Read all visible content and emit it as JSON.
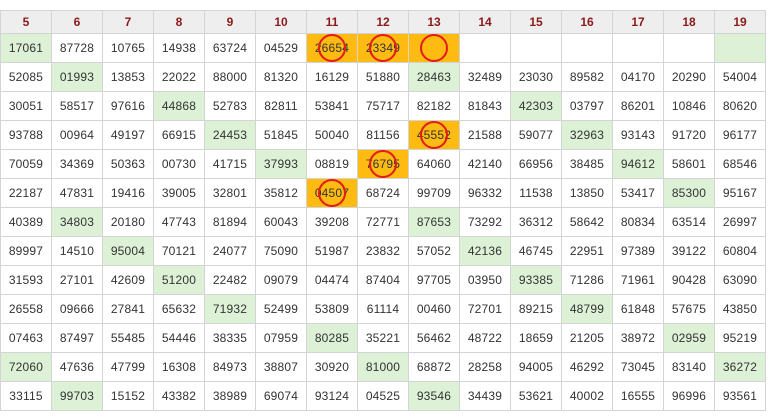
{
  "headers": [
    "5",
    "6",
    "7",
    "8",
    "9",
    "10",
    "11",
    "12",
    "13",
    "14",
    "15",
    "16",
    "17",
    "18",
    "19"
  ],
  "rows": [
    [
      "17061",
      "87728",
      "10765",
      "14938",
      "63724",
      "04529",
      "26654",
      "23349",
      "",
      "",
      "",
      "",
      "",
      "",
      ""
    ],
    [
      "52085",
      "01993",
      "13853",
      "22022",
      "88000",
      "81320",
      "16129",
      "51880",
      "28463",
      "32489",
      "23030",
      "89582",
      "04170",
      "20290",
      "54004"
    ],
    [
      "30051",
      "58517",
      "97616",
      "44868",
      "52783",
      "82811",
      "53841",
      "75717",
      "82182",
      "81843",
      "42303",
      "03797",
      "86201",
      "10846",
      "80620"
    ],
    [
      "93788",
      "00964",
      "49197",
      "66915",
      "24453",
      "51845",
      "50040",
      "81156",
      "45552",
      "21588",
      "59077",
      "32963",
      "93143",
      "91720",
      "96177"
    ],
    [
      "70059",
      "34369",
      "50363",
      "00730",
      "41715",
      "37993",
      "08819",
      "76795",
      "64060",
      "42140",
      "66956",
      "38485",
      "94612",
      "58601",
      "68546"
    ],
    [
      "22187",
      "47831",
      "19416",
      "39005",
      "32801",
      "35812",
      "04507",
      "68724",
      "99709",
      "96332",
      "11538",
      "13850",
      "53417",
      "85300",
      "95167"
    ],
    [
      "40389",
      "34803",
      "20180",
      "47743",
      "81894",
      "60043",
      "39208",
      "72771",
      "87653",
      "73292",
      "36312",
      "58642",
      "80834",
      "63514",
      "26997"
    ],
    [
      "89997",
      "14510",
      "95004",
      "70121",
      "24077",
      "75090",
      "51987",
      "23832",
      "57052",
      "42136",
      "46745",
      "22951",
      "97389",
      "39122",
      "60804"
    ],
    [
      "31593",
      "27101",
      "42609",
      "51200",
      "22482",
      "09079",
      "04474",
      "87404",
      "97705",
      "03950",
      "93385",
      "71286",
      "71961",
      "90428",
      "63090"
    ],
    [
      "26558",
      "09666",
      "27841",
      "65632",
      "71932",
      "52499",
      "53809",
      "61114",
      "00460",
      "72701",
      "89215",
      "48799",
      "61848",
      "57675",
      "43850"
    ],
    [
      "07463",
      "87497",
      "55485",
      "54446",
      "38335",
      "07959",
      "80285",
      "35221",
      "56462",
      "48722",
      "18659",
      "21205",
      "38972",
      "02959",
      "95219"
    ],
    [
      "72060",
      "47636",
      "47799",
      "16308",
      "84973",
      "38807",
      "30920",
      "81000",
      "68872",
      "28258",
      "94005",
      "46292",
      "73045",
      "83140",
      "36272"
    ],
    [
      "33115",
      "99703",
      "15152",
      "43382",
      "38989",
      "69074",
      "93124",
      "04525",
      "93546",
      "34439",
      "53621",
      "40002",
      "16555",
      "96996",
      "93561"
    ]
  ],
  "highlights": {
    "green": [
      [
        0,
        0
      ],
      [
        0,
        14
      ],
      [
        1,
        1
      ],
      [
        1,
        8
      ],
      [
        2,
        3
      ],
      [
        2,
        10
      ],
      [
        3,
        4
      ],
      [
        3,
        11
      ],
      [
        4,
        5
      ],
      [
        4,
        12
      ],
      [
        5,
        13
      ],
      [
        6,
        1
      ],
      [
        6,
        8
      ],
      [
        7,
        2
      ],
      [
        7,
        9
      ],
      [
        8,
        3
      ],
      [
        8,
        10
      ],
      [
        9,
        4
      ],
      [
        9,
        11
      ],
      [
        10,
        6
      ],
      [
        10,
        13
      ],
      [
        11,
        0
      ],
      [
        11,
        7
      ],
      [
        11,
        14
      ],
      [
        12,
        1
      ],
      [
        12,
        8
      ]
    ],
    "orange": [
      [
        0,
        6
      ],
      [
        0,
        7
      ],
      [
        0,
        8
      ],
      [
        3,
        8
      ],
      [
        4,
        7
      ],
      [
        5,
        6
      ]
    ],
    "circled": [
      [
        0,
        6
      ],
      [
        0,
        7
      ],
      [
        0,
        8
      ],
      [
        3,
        8
      ],
      [
        4,
        7
      ],
      [
        5,
        6
      ]
    ]
  },
  "colors": {
    "green": "#dcf1d6",
    "orange": "#ffbb11",
    "header_text": "#8b1a1a",
    "ring": "#e21b1b"
  }
}
